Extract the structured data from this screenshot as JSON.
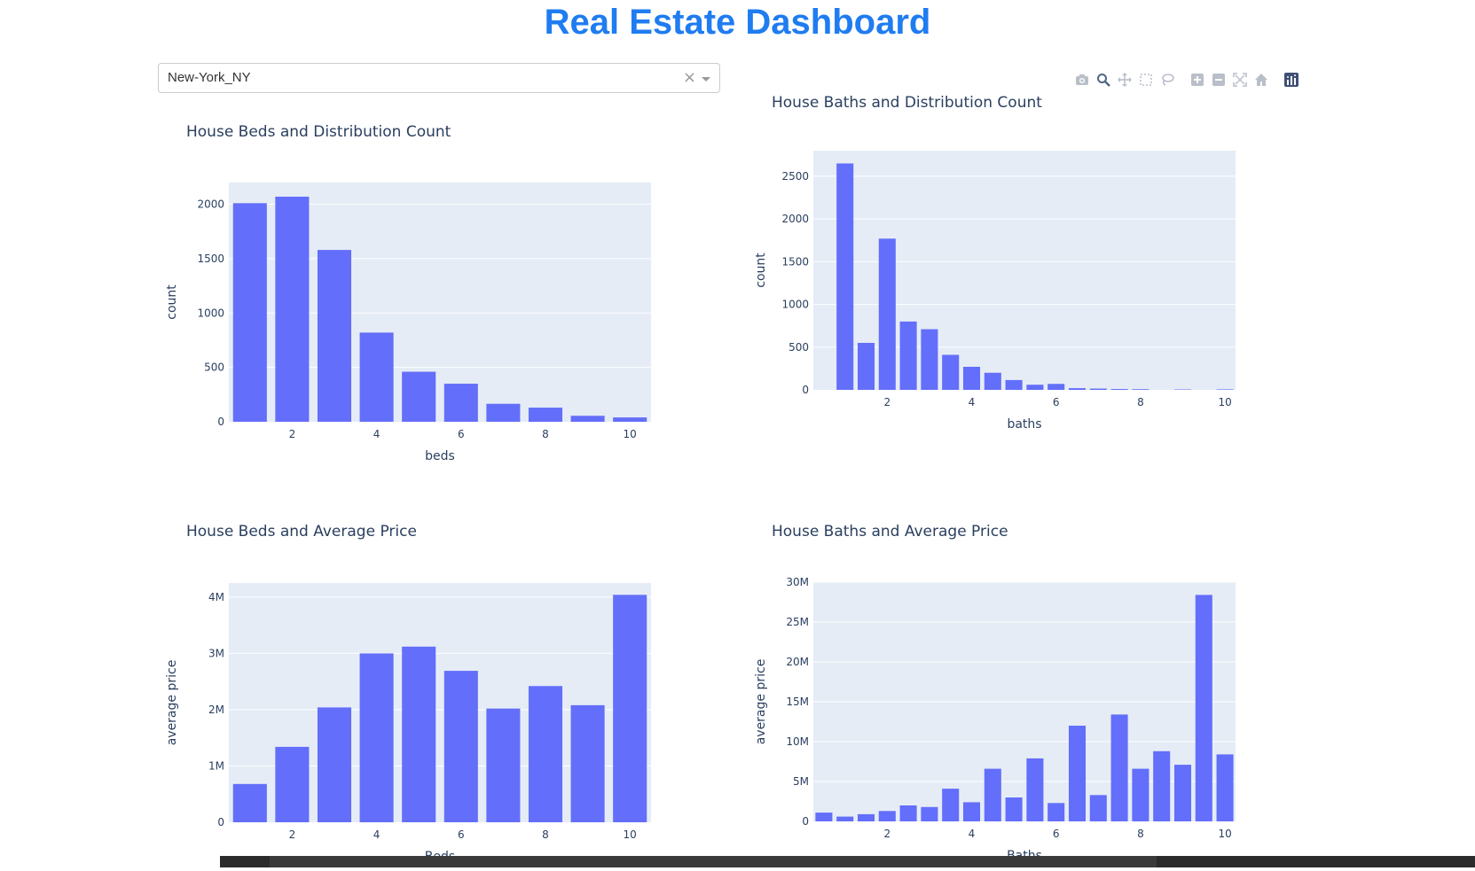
{
  "page": {
    "title": "Real Estate Dashboard"
  },
  "filter": {
    "selected": "New-York_NY",
    "clear_symbol": "×"
  },
  "modebar": {
    "icons": [
      "camera-icon",
      "zoom-icon",
      "pan-icon",
      "box-select-icon",
      "lasso-icon",
      "zoom-in-icon",
      "zoom-out-icon",
      "autoscale-icon",
      "reset-axes-icon",
      "plotly-logo-icon"
    ]
  },
  "colors": {
    "bar": "#636efa",
    "plot_bg": "#e5ecf6",
    "title": "#1f7cf1",
    "text": "#2a3f5f"
  },
  "chart_data": [
    {
      "type": "bar",
      "title": "House Beds and Distribution Count",
      "xlabel": "beds",
      "ylabel": "count",
      "x": [
        1,
        2,
        3,
        4,
        5,
        6,
        7,
        8,
        9,
        10
      ],
      "values": [
        2010,
        2070,
        1580,
        820,
        460,
        350,
        165,
        130,
        55,
        40
      ],
      "xlim": [
        0.5,
        10.5
      ],
      "ylim": [
        0,
        2200
      ],
      "xticks": [
        2,
        4,
        6,
        8,
        10
      ],
      "yticks": [
        0,
        500,
        1000,
        1500,
        2000
      ],
      "ytick_labels": [
        "0",
        "500",
        "1000",
        "1500",
        "2000"
      ],
      "grid": true
    },
    {
      "type": "bar",
      "title": "House Baths and Distribution Count",
      "xlabel": "baths",
      "ylabel": "count",
      "x": [
        1,
        1.5,
        2,
        2.5,
        3,
        3.5,
        4,
        4.5,
        5,
        5.5,
        6,
        6.5,
        7,
        7.5,
        8,
        9,
        10
      ],
      "values": [
        2650,
        550,
        1770,
        800,
        710,
        410,
        270,
        200,
        115,
        60,
        70,
        20,
        15,
        10,
        8,
        5,
        6
      ],
      "xlim": [
        0.25,
        10.25
      ],
      "ylim": [
        0,
        2800
      ],
      "xticks": [
        2,
        4,
        6,
        8,
        10
      ],
      "yticks": [
        0,
        500,
        1000,
        1500,
        2000,
        2500
      ],
      "ytick_labels": [
        "0",
        "500",
        "1000",
        "1500",
        "2000",
        "2500"
      ],
      "grid": true
    },
    {
      "type": "bar",
      "title": "House Beds and Average Price",
      "xlabel": "Beds",
      "ylabel": "average price",
      "x": [
        1,
        2,
        3,
        4,
        5,
        6,
        7,
        8,
        9,
        10
      ],
      "values": [
        680000,
        1340000,
        2040000,
        3000000,
        3120000,
        2690000,
        2020000,
        2420000,
        2080000,
        4040000
      ],
      "xlim": [
        0.5,
        10.5
      ],
      "ylim": [
        0,
        4250000
      ],
      "xticks": [
        2,
        4,
        6,
        8,
        10
      ],
      "yticks": [
        0,
        1000000,
        2000000,
        3000000,
        4000000
      ],
      "ytick_labels": [
        "0",
        "1M",
        "2M",
        "3M",
        "4M"
      ],
      "grid": true
    },
    {
      "type": "bar",
      "title": "House Baths and Average Price",
      "xlabel": "Baths",
      "ylabel": "average price",
      "x": [
        0.5,
        1,
        1.5,
        2,
        2.5,
        3,
        3.5,
        4,
        4.5,
        5,
        5.5,
        6,
        6.5,
        7,
        7.5,
        8,
        8.5,
        9,
        9.5,
        10
      ],
      "values": [
        1100000,
        600000,
        900000,
        1300000,
        2000000,
        1800000,
        4100000,
        2400000,
        6600000,
        3000000,
        7900000,
        2300000,
        12000000,
        3300000,
        13400000,
        6600000,
        8800000,
        7100000,
        28400000,
        8400000
      ],
      "xlim": [
        0.25,
        10.25
      ],
      "ylim": [
        0,
        30000000
      ],
      "xticks": [
        2,
        4,
        6,
        8,
        10
      ],
      "yticks": [
        0,
        5000000,
        10000000,
        15000000,
        20000000,
        25000000,
        30000000
      ],
      "ytick_labels": [
        "0",
        "5M",
        "10M",
        "15M",
        "20M",
        "25M",
        "30M"
      ],
      "grid": true
    }
  ]
}
